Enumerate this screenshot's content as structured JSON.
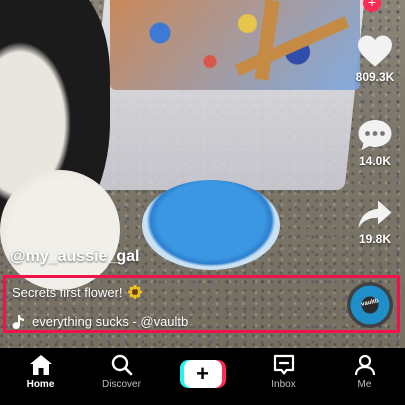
{
  "video": {
    "username": "@my_aussie_gal",
    "caption": "Secrets first flower!",
    "caption_emoji": "sunflower-icon",
    "sound": "everything sucks - @vaultb",
    "disc_label": "vaultb"
  },
  "actions": {
    "like_count": "809.3K",
    "comment_count": "14.0K",
    "share_count": "19.8K"
  },
  "follow_badge": "+",
  "nav": {
    "home": "Home",
    "discover": "Discover",
    "create": "+",
    "inbox": "Inbox",
    "me": "Me"
  },
  "colors": {
    "highlight": "#f2124b",
    "accent_red": "#fe2c55",
    "accent_cyan": "#25f4ee"
  }
}
